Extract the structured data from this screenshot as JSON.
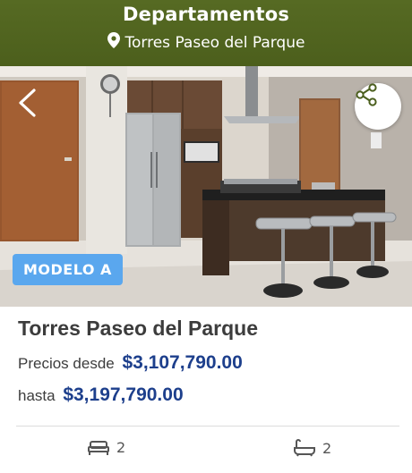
{
  "header": {
    "title": "Departamentos",
    "location": "Torres Paseo del Parque",
    "location_icon": "map-pin-icon"
  },
  "photo": {
    "alt": "Modelo A",
    "badge": "MODELO A",
    "back_icon": "chevron-left-icon",
    "share_icon": "share-icon"
  },
  "listing": {
    "name": "Torres Paseo del Parque",
    "price_from_label": "Precios desde",
    "price_from": "$3,107,790.00",
    "price_to_label": "hasta",
    "price_to": "$3,197,790.00"
  },
  "features": {
    "bedrooms": "2",
    "bedrooms_icon": "bed-icon",
    "bathrooms": "2",
    "bathrooms_icon": "bathtub-icon"
  },
  "colors": {
    "header_bg": "#566a23",
    "badge_bg": "#5aa7ee",
    "price_color": "#1d3f8c"
  }
}
